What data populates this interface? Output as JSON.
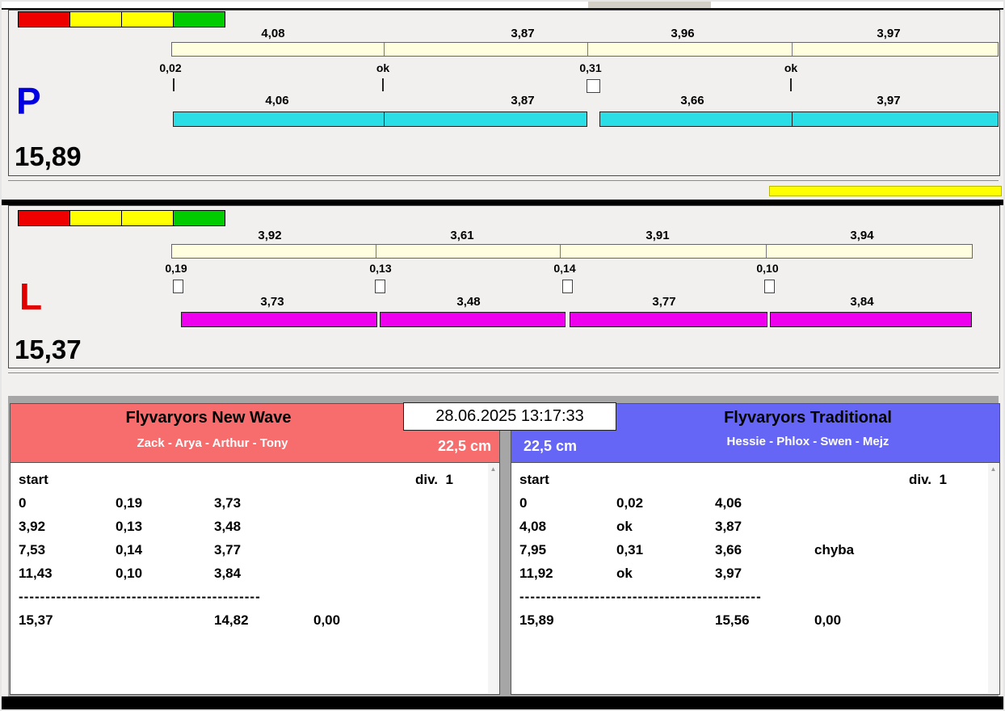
{
  "window": {
    "datetime": "28.06.2025 13:17:33",
    "indicator_color": "#ffff00"
  },
  "lane_p": {
    "letter": "P",
    "letter_color": "#0000e0",
    "total": "15,89",
    "legend": [
      "#ee0000",
      "#ffff00",
      "#ffff00",
      "#00cc00"
    ],
    "ref_bar_color": "#ffffe0",
    "run_bar_color": "#2bdde4",
    "ref_values": [
      "4,08",
      "3,87",
      "3,96",
      "3,97"
    ],
    "diff_labels": [
      "0,02",
      "ok",
      "0,31",
      "ok"
    ],
    "run_values": [
      "4,06",
      "3,87",
      "3,66",
      "3,97"
    ]
  },
  "lane_l": {
    "letter": "L",
    "letter_color": "#e00000",
    "total": "15,37",
    "legend": [
      "#ee0000",
      "#ffff00",
      "#ffff00",
      "#00cc00"
    ],
    "ref_bar_color": "#ffffe0",
    "run_bar_color": "#ee00ee",
    "ref_values": [
      "3,92",
      "3,61",
      "3,91",
      "3,94"
    ],
    "diff_labels": [
      "0,19",
      "0,13",
      "0,14",
      "0,10"
    ],
    "run_values": [
      "3,73",
      "3,48",
      "3,77",
      "3,84"
    ]
  },
  "left_team": {
    "name": "Flyvaryors New Wave",
    "members": "Zack - Arya - Arthur - Tony",
    "size_label": "22,5 cm",
    "header_color": "#f76c6c",
    "start_label": "start",
    "div_label": "div.  1",
    "rows": [
      {
        "t": "0",
        "d": "0,19",
        "v": "3,73",
        "note": ""
      },
      {
        "t": "3,92",
        "d": "0,13",
        "v": "3,48",
        "note": ""
      },
      {
        "t": "7,53",
        "d": "0,14",
        "v": "3,77",
        "note": ""
      },
      {
        "t": "11,43",
        "d": "0,10",
        "v": "3,84",
        "note": ""
      }
    ],
    "separator": "---------------------------------------------",
    "total": "15,37",
    "sum": "14,82",
    "penalty": "0,00"
  },
  "right_team": {
    "name": "Flyvaryors Traditional",
    "members": "Hessie - Phlox - Swen - Mejz",
    "size_label": "22,5 cm",
    "header_color": "#6565f6",
    "start_label": "start",
    "div_label": "div.  1",
    "rows": [
      {
        "t": "0",
        "d": "0,02",
        "v": "4,06",
        "note": ""
      },
      {
        "t": "4,08",
        "d": "ok",
        "v": "3,87",
        "note": ""
      },
      {
        "t": "7,95",
        "d": "0,31",
        "v": "3,66",
        "note": "chyba"
      },
      {
        "t": "11,92",
        "d": "ok",
        "v": "3,97",
        "note": ""
      }
    ],
    "separator": "---------------------------------------------",
    "total": "15,89",
    "sum": "15,56",
    "penalty": "0,00"
  }
}
